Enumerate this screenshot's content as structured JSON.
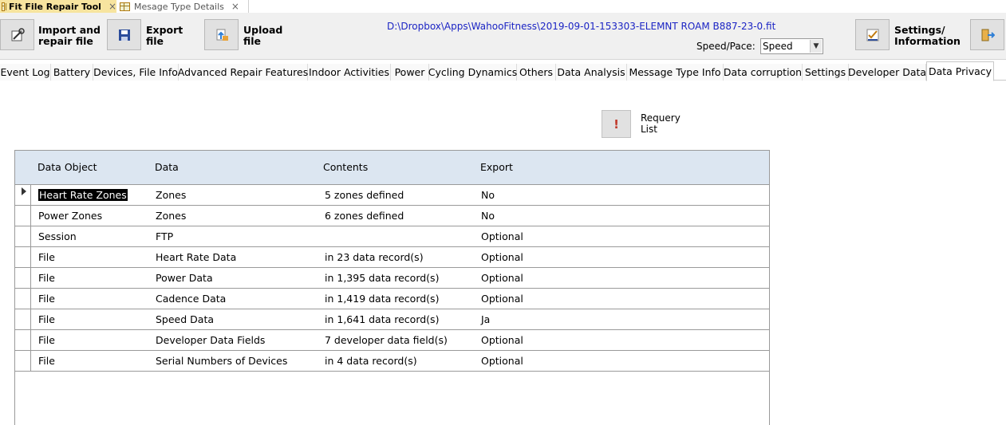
{
  "doc_tabs": [
    {
      "label": "Fit File Repair Tool",
      "close": "×"
    },
    {
      "label": "Mesage Type Details",
      "close": "×"
    }
  ],
  "toolbar": {
    "import_label": "Import and\nrepair file",
    "export_label": "Export\nfile",
    "upload_label": "Upload\nfile",
    "file_path": "D:\\Dropbox\\Apps\\WahooFitness\\2019-09-01-153303-ELEMNT ROAM B887-23-0.fit",
    "speed_pace_label": "Speed/Pace:",
    "speed_pace_value": "Speed",
    "settings_label": "Settings/\nInformation"
  },
  "func_tabs": [
    "Event Log",
    "Battery",
    "Devices, File Info",
    "Advanced Repair Features",
    "Indoor Activities",
    "Power",
    "Cycling Dynamics",
    "Others",
    "Data Analysis",
    "Message Type Info",
    "Data corruption",
    "Settings",
    "Developer Data",
    "Data Privacy"
  ],
  "requery_label": "Requery\nList",
  "table": {
    "headers": [
      "Data Object",
      "Data",
      "Contents",
      "Export"
    ],
    "rows": [
      [
        "Heart Rate Zones",
        "Zones",
        "5 zones defined",
        "No"
      ],
      [
        "Power Zones",
        "Zones",
        "6 zones defined",
        "No"
      ],
      [
        "Session",
        "FTP",
        "",
        "Optional"
      ],
      [
        "File",
        "Heart Rate Data",
        "in 23 data record(s)",
        "Optional"
      ],
      [
        "File",
        "Power Data",
        "in 1,395 data record(s)",
        "Optional"
      ],
      [
        "File",
        "Cadence Data",
        "in 1,419 data record(s)",
        "Optional"
      ],
      [
        "File",
        "Speed Data",
        "in 1,641 data record(s)",
        "Ja"
      ],
      [
        "File",
        "Developer Data Fields",
        "7 developer data field(s)",
        "Optional"
      ],
      [
        "File",
        "Serial Numbers of Devices",
        "in 4 data record(s)",
        "Optional"
      ]
    ]
  },
  "icons": {
    "import": "wrench-file-icon",
    "export": "floppy-disk-icon",
    "upload": "upload-icon",
    "settings": "settings-check-icon",
    "exit": "exit-door-icon",
    "requery": "exclamation-icon"
  }
}
